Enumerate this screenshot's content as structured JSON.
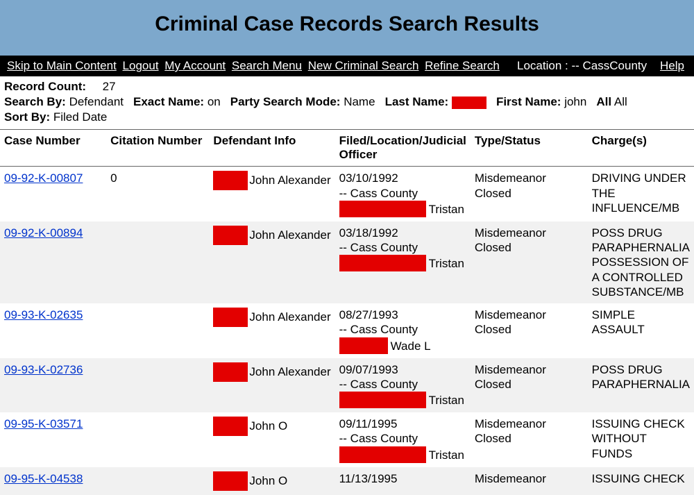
{
  "banner": {
    "title": "Criminal Case Records Search Results"
  },
  "nav": {
    "links": [
      "Skip to Main Content",
      "Logout",
      "My Account",
      "Search Menu",
      "New Criminal Search",
      "Refine Search"
    ],
    "location_label": "Location :",
    "location_value": "-- CassCounty",
    "help": "Help"
  },
  "meta": {
    "record_count_label": "Record Count:",
    "record_count": "27",
    "search_by_label": "Search By:",
    "search_by": "Defendant",
    "exact_name_label": "Exact Name:",
    "exact_name": "on",
    "party_mode_label": "Party Search Mode:",
    "party_mode": "Name",
    "last_name_label": "Last Name:",
    "first_name_label": "First Name:",
    "first_name": "john",
    "all_label": "All",
    "all_value": "All",
    "sort_by_label": "Sort By:",
    "sort_by": "Filed Date"
  },
  "columns": {
    "case": "Case Number",
    "citation": "Citation Number",
    "defendant": "Defendant Info",
    "filed": "Filed/Location/Judicial Officer",
    "type": "Type/Status",
    "charges": "Charge(s)"
  },
  "rows": [
    {
      "case": "09-92-K-00807",
      "citation": "0",
      "def_name": "John Alexander",
      "filed_date": "03/10/1992",
      "location": "-- Cass County",
      "officer": "Tristan",
      "officer_redact": "wide",
      "type": "Misdemeanor",
      "status": "Closed",
      "charges": "DRIVING UNDER THE INFLUENCE/MB"
    },
    {
      "case": "09-92-K-00894",
      "citation": "",
      "def_name": "John Alexander",
      "filed_date": "03/18/1992",
      "location": "-- Cass County",
      "officer": "Tristan",
      "officer_redact": "wide",
      "type": "Misdemeanor",
      "status": "Closed",
      "charges": "POSS DRUG PARAPHERNALIA POSSESSION OF A CONTROLLED SUBSTANCE/MB"
    },
    {
      "case": "09-93-K-02635",
      "citation": "",
      "def_name": "John Alexander",
      "filed_date": "08/27/1993",
      "location": "-- Cass County",
      "officer": "Wade L",
      "officer_redact": "mid",
      "type": "Misdemeanor",
      "status": "Closed",
      "charges": "SIMPLE ASSAULT"
    },
    {
      "case": "09-93-K-02736",
      "citation": "",
      "def_name": "John Alexander",
      "filed_date": "09/07/1993",
      "location": "-- Cass County",
      "officer": "Tristan",
      "officer_redact": "wide",
      "type": "Misdemeanor",
      "status": "Closed",
      "charges": "POSS DRUG PARAPHERNALIA"
    },
    {
      "case": "09-95-K-03571",
      "citation": "",
      "def_name": "John O",
      "filed_date": "09/11/1995",
      "location": "-- Cass County",
      "officer": "Tristan",
      "officer_redact": "wide",
      "type": "Misdemeanor",
      "status": "Closed",
      "charges": "ISSUING CHECK WITHOUT FUNDS"
    },
    {
      "case": "09-95-K-04538",
      "citation": "",
      "def_name": "John O",
      "filed_date": "11/13/1995",
      "location": "",
      "officer": "",
      "officer_redact": "",
      "type": "Misdemeanor",
      "status": "",
      "charges": "ISSUING CHECK"
    }
  ]
}
